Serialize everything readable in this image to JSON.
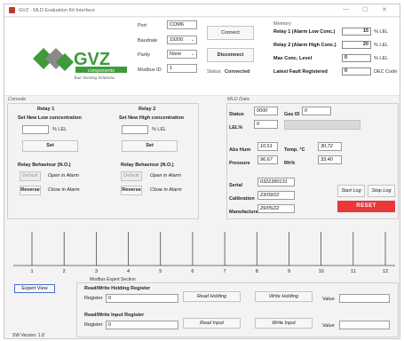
{
  "window": {
    "title": "GVZ - MLD Evaluation Kit Interface",
    "controls": [
      "—",
      "☐",
      "✕"
    ]
  },
  "header": {
    "logo": {
      "brand": "GVZ",
      "sub": "components",
      "tagline": "Your Sensing Solutions"
    },
    "port_label": "Port",
    "port_value": "COM6",
    "baud_label": "Baudrate",
    "baud_value": "19200",
    "parity_label": "Parity",
    "parity_value": "None",
    "modbus_label": "Modbus ID",
    "modbus_value": "1",
    "connect_label": "Connect",
    "disconnect_label": "Disconnect",
    "status_label": "Status",
    "status_value": "Connected"
  },
  "memory": {
    "title": "Memory",
    "rows": [
      {
        "label": "Relay 1 (Alarm Low Conc.)",
        "value": "15",
        "unit": "% LEL"
      },
      {
        "label": "Relay 2 (Alarm High Conc.)",
        "value": "20",
        "unit": "% LEL"
      },
      {
        "label": "Max Conc. Level",
        "value": "0",
        "unit": "% LEL"
      },
      {
        "label": "Latest Fault Registered",
        "value": "0",
        "unit": "DEC Code"
      }
    ]
  },
  "console": {
    "title": "Console",
    "relay1": {
      "title": "Relay 1",
      "set_label": "Set New Low concentration",
      "unit": "% LEL",
      "set_button": "Set",
      "behaviour_title": "Relay Behaviour (N.O.)",
      "default_button": "Default",
      "default_text": "Open in Alarm",
      "reverse_button": "Reverse",
      "reverse_text": "Close in Alarm"
    },
    "relay2": {
      "title": "Relay 2",
      "set_label": "Set New High concentration",
      "unit": "% LEL",
      "set_button": "Set",
      "behaviour_title": "Relay Behaviour (N.O.)",
      "default_button": "Default",
      "default_text": "Open in Alarm",
      "reverse_button": "Reverse",
      "reverse_text": "Close in Alarm"
    }
  },
  "mld": {
    "title": "MLD Data",
    "status_label": "Status",
    "status_value": "0000",
    "gasid_label": "Gas ID",
    "gasid_value": "0",
    "lel_label": "LEL%",
    "lel_value": "0",
    "abs_hum_label": "Abs Hum",
    "abs_hum_value": "10,51",
    "temp_label": "Temp. °C",
    "temp_value": "30,72",
    "pressure_label": "Pressure",
    "pressure_value": "96,67",
    "rh_label": "Rh%",
    "rh_value": "33,40",
    "serial_label": "Serial",
    "serial_value": "0322390131",
    "calibration_label": "Calibration",
    "calibration_value": "23/09/22",
    "manufacture_label": "Manufacture",
    "manufacture_value": "29/05/22",
    "start_log": "Start Log",
    "stop_log": "Stop Log",
    "reset": "RESET"
  },
  "chart_data": {
    "type": "line",
    "x_ticks": [
      "1",
      "2",
      "3",
      "4",
      "5",
      "6",
      "7",
      "8",
      "9",
      "10",
      "11",
      "12"
    ]
  },
  "modbus": {
    "expert_view": "Expert View",
    "title": "Modbus Expert Section",
    "holding_title": "Read/Write Holding Register",
    "holding_register_label": "Register",
    "holding_register_value": "0",
    "read_holding": "Read Holding",
    "write_holding": "Write Holding",
    "holding_value_label": "Value",
    "holding_value": "",
    "input_title": "Read/Write Input Register",
    "input_register_label": "Register",
    "input_register_value": "0",
    "read_input": "Read Input",
    "write_input": "Write Input",
    "input_value_label": "Value",
    "input_value": "",
    "sw_version": "SW Version: 1.8"
  },
  "colors": {
    "logo_green": "#3f9a3c",
    "logo_gray": "#8a8a8a",
    "reset_red": "#e8383a"
  }
}
